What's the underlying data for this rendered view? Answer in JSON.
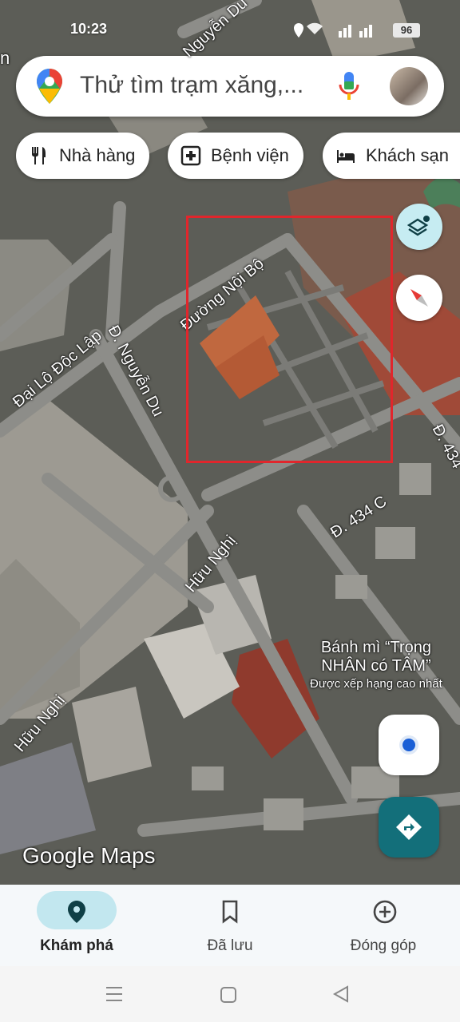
{
  "status_bar": {
    "time": "10:23",
    "battery": "96"
  },
  "search": {
    "placeholder": "Thử tìm trạm xăng,..."
  },
  "chips": [
    {
      "label": "Nhà hàng",
      "icon": "restaurant-icon"
    },
    {
      "label": "Bệnh viện",
      "icon": "hospital-icon"
    },
    {
      "label": "Khách sạn",
      "icon": "hotel-icon"
    }
  ],
  "map_labels": {
    "nguyen_du_top": "Nguyễn Du",
    "duong_noi_bo": "Đường Nội Bộ",
    "dai_lo_doc_lap": "Đại Lộ Độc Lập",
    "d_nguyen_du": "Đ. Nguyễn Du",
    "d_434": "Đ. 434",
    "d_434c": "Đ. 434 C",
    "huu_nghi_1": "Hữu Nghị",
    "huu_nghi_2": "Hữu Nghị",
    "left_cut": "n"
  },
  "poi": {
    "name_line1": "Bánh mì “Trọng",
    "name_line2": "NHÂN có TÂM”",
    "subtitle": "Được xếp hạng cao nhất"
  },
  "logo_text": "Google Maps",
  "bottom_nav": [
    {
      "label": "Khám phá",
      "icon": "explore-pin-icon",
      "active": true
    },
    {
      "label": "Đã lưu",
      "icon": "bookmark-icon",
      "active": false
    },
    {
      "label": "Đóng góp",
      "icon": "add-circle-icon",
      "active": false
    }
  ],
  "colors": {
    "accent": "#136f7a",
    "highlight": "#e1262c",
    "active_pill": "#c2e7ef",
    "location_dot": "#1a5fd6"
  }
}
